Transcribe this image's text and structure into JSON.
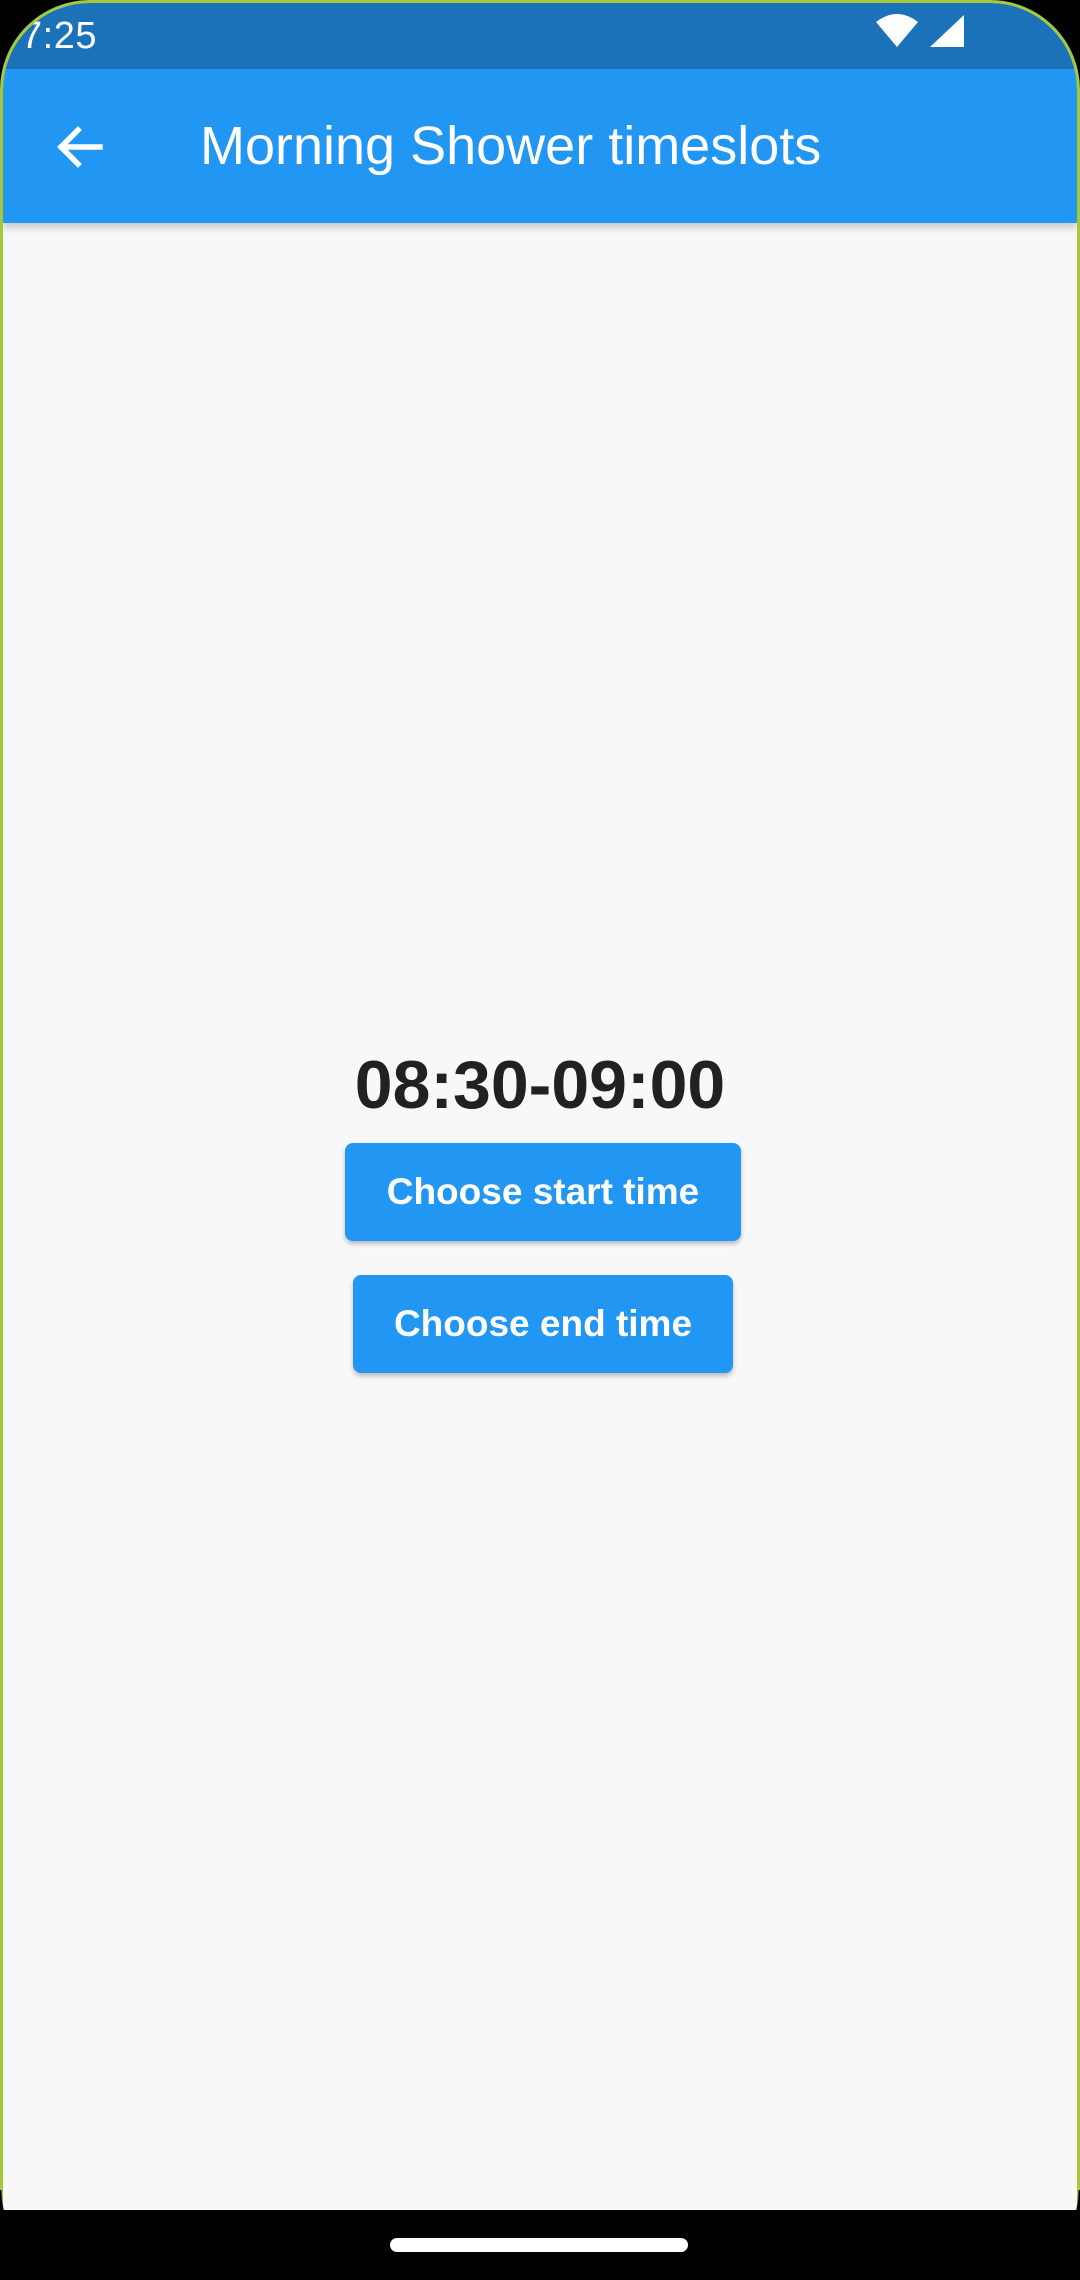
{
  "status_bar": {
    "time": "7:25",
    "icons": [
      "wifi-icon",
      "cellular-signal-icon"
    ],
    "color": "#1b72b9"
  },
  "app_bar": {
    "title": "Morning Shower timeslots",
    "back_icon": "arrow-left-icon",
    "color": "#2196f3"
  },
  "main": {
    "time_range": "08:30-09:00",
    "start_button_label": "Choose start time",
    "end_button_label": "Choose end time",
    "button_color": "#2196f3"
  }
}
